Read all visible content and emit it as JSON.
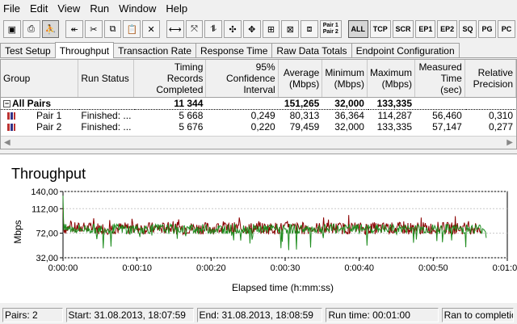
{
  "menu": [
    "File",
    "Edit",
    "View",
    "Run",
    "Window",
    "Help"
  ],
  "toolbar": {
    "protocol_buttons": [
      "ALL",
      "TCP",
      "SCR",
      "EP1",
      "EP2",
      "SQ",
      "PG",
      "PC"
    ],
    "pair_button": "Pair 1\nPair 2"
  },
  "tabs": [
    "Test Setup",
    "Throughput",
    "Transaction Rate",
    "Response Time",
    "Raw Data Totals",
    "Endpoint Configuration"
  ],
  "active_tab": "Throughput",
  "table": {
    "headers": [
      "Group",
      "Run Status",
      "Timing Records Completed",
      "95% Confidence Interval",
      "Average (Mbps)",
      "Minimum (Mbps)",
      "Maximum (Mbps)",
      "Measured Time (sec)",
      "Relative Precision"
    ],
    "summary": {
      "label": "All Pairs",
      "records": "11 344",
      "average": "151,265",
      "minimum": "32,000",
      "maximum": "133,335"
    },
    "rows": [
      {
        "name": "Pair 1",
        "status": "Finished: ...",
        "records": "5 668",
        "confidence": "0,249",
        "average": "80,313",
        "minimum": "36,364",
        "maximum": "114,287",
        "time": "56,460",
        "precision": "0,310"
      },
      {
        "name": "Pair 2",
        "status": "Finished: ...",
        "records": "5 676",
        "confidence": "0,220",
        "average": "79,459",
        "minimum": "32,000",
        "maximum": "133,335",
        "time": "57,147",
        "precision": "0,277"
      }
    ]
  },
  "chart_data": {
    "type": "line",
    "title": "Throughput",
    "xlabel": "Elapsed time (h:mm:ss)",
    "ylabel": "Mbps",
    "xticks": [
      "0:00:00",
      "0:00:10",
      "0:00:20",
      "0:00:30",
      "0:00:40",
      "0:00:50",
      "0:01:00"
    ],
    "yticks": [
      "140,00",
      "112,00",
      "72,00",
      "32,00"
    ],
    "ylim": [
      32,
      140
    ],
    "xlim": [
      0,
      60
    ],
    "series": [
      {
        "name": "Pair 1",
        "color": "#8b0000",
        "x": [
          0,
          5,
          10,
          15,
          20,
          25,
          30,
          35,
          40,
          45,
          50,
          55,
          56.46
        ],
        "values": [
          114,
          100,
          85,
          100,
          80,
          100,
          90,
          100,
          85,
          100,
          80,
          100,
          80
        ],
        "baseline": 80
      },
      {
        "name": "Pair 2",
        "color": "#1e8c1e",
        "x": [
          0,
          5,
          10,
          15,
          20,
          25,
          30,
          35,
          40,
          45,
          50,
          55,
          57.15
        ],
        "values": [
          133,
          80,
          70,
          80,
          75,
          80,
          72,
          80,
          70,
          78,
          75,
          80,
          79
        ],
        "baseline": 79
      }
    ]
  },
  "status": {
    "pairs": "Pairs: 2",
    "start": "Start: 31.08.2013, 18:07:59",
    "end": "End: 31.08.2013, 18:08:59",
    "runtime": "Run time: 00:01:00",
    "ran": "Ran to completion"
  }
}
